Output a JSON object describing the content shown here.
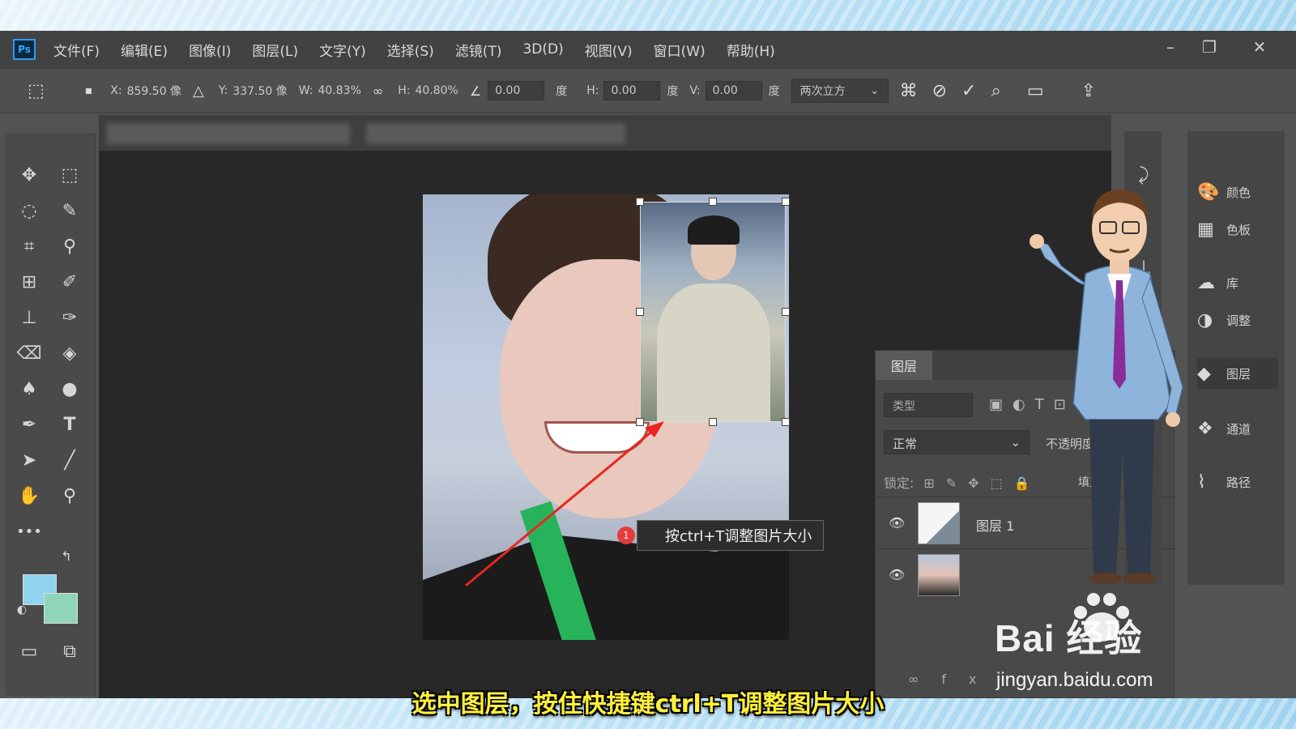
{
  "app": {
    "logo": "Ps"
  },
  "menubar": {
    "items": [
      "文件(F)",
      "编辑(E)",
      "图像(I)",
      "图层(L)",
      "文字(Y)",
      "选择(S)",
      "滤镜(T)",
      "3D(D)",
      "视图(V)",
      "窗口(W)",
      "帮助(H)"
    ]
  },
  "options": {
    "x_label": "X:",
    "x_value": "859.50 像",
    "y_label": "Y:",
    "y_value": "337.50 像",
    "w_label": "W:",
    "w_value": "40.83%",
    "h_label": "H:",
    "h_value": "40.80%",
    "angle_value": "0.00",
    "angle_unit": "度",
    "hskew_label": "H:",
    "hskew_value": "0.00",
    "hskew_unit": "度",
    "vskew_label": "V:",
    "vskew_value": "0.00",
    "vskew_unit": "度",
    "interp_value": "两次立方"
  },
  "canvas": {
    "tip_badge": "1",
    "tip_text": "按ctrl+T调整图片大小"
  },
  "layers_panel": {
    "tab": "图层",
    "filter_placeholder": "类型",
    "blend_mode": "正常",
    "opacity_label": "不透明度",
    "lock_label": "锁定:",
    "fill_label": "填充",
    "layers": [
      {
        "name": "图层 1"
      },
      {
        "name": ""
      }
    ]
  },
  "right_panel": {
    "items": [
      {
        "label": "颜色",
        "icon": "palette-icon"
      },
      {
        "label": "色板",
        "icon": "swatches-icon"
      },
      {
        "label": "库",
        "icon": "libraries-icon"
      },
      {
        "label": "调整",
        "icon": "adjustments-icon"
      },
      {
        "label": "图层",
        "icon": "layers-icon"
      },
      {
        "label": "通道",
        "icon": "channels-icon"
      },
      {
        "label": "路径",
        "icon": "paths-icon"
      }
    ]
  },
  "subtitle": "选中图层，按住快捷键ctrl+T调整图片大小",
  "watermark": {
    "logo": "Bai  经验",
    "url": "jingyan.baidu.com"
  },
  "colors": {
    "foreground": "#8fd3ee",
    "background": "#8fd6b8",
    "subtitle": "#ffef3b"
  }
}
